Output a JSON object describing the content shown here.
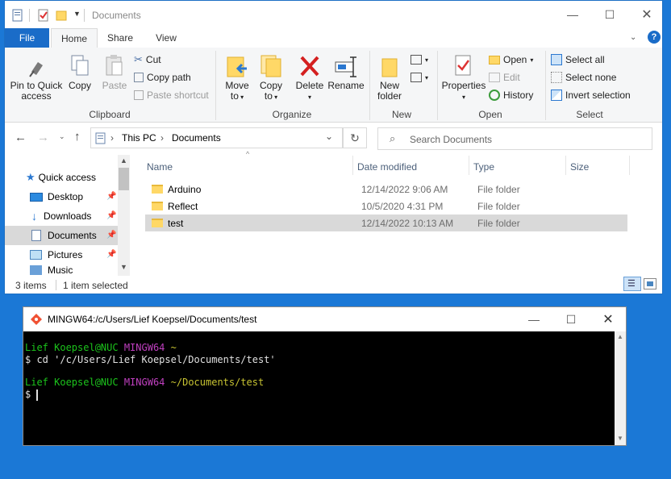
{
  "explorer": {
    "title": "Documents",
    "tabs": {
      "file": "File",
      "home": "Home",
      "share": "Share",
      "view": "View"
    },
    "ribbon": {
      "clipboard": {
        "pin": "Pin to Quick access",
        "copy": "Copy",
        "paste": "Paste",
        "cut": "Cut",
        "copy_path": "Copy path",
        "paste_shortcut": "Paste shortcut",
        "label": "Clipboard"
      },
      "organize": {
        "move_to": "Move to",
        "copy_to": "Copy to",
        "delete": "Delete",
        "rename": "Rename",
        "label": "Organize"
      },
      "new": {
        "new_folder": "New folder",
        "label": "New"
      },
      "open": {
        "properties": "Properties",
        "open": "Open",
        "edit": "Edit",
        "history": "History",
        "label": "Open"
      },
      "select": {
        "select_all": "Select all",
        "select_none": "Select none",
        "invert": "Invert selection",
        "label": "Select"
      }
    },
    "address": {
      "this_pc": "This PC",
      "documents": "Documents"
    },
    "search_placeholder": "Search Documents",
    "nav": {
      "quick_access": "Quick access",
      "items": [
        "Desktop",
        "Downloads",
        "Documents",
        "Pictures",
        "Music"
      ]
    },
    "columns": {
      "name": "Name",
      "date": "Date modified",
      "type": "Type",
      "size": "Size"
    },
    "files": [
      {
        "name": "Arduino",
        "date": "12/14/2022 9:06 AM",
        "type": "File folder"
      },
      {
        "name": "Reflect",
        "date": "10/5/2020 4:31 PM",
        "type": "File folder"
      },
      {
        "name": "test",
        "date": "12/14/2022 10:13 AM",
        "type": "File folder"
      }
    ],
    "status": {
      "count": "3 items",
      "selected": "1 item selected"
    }
  },
  "terminal": {
    "title": "MINGW64:/c/Users/Lief Koepsel/Documents/test",
    "line1_user": "Lief Koepsel@NUC",
    "line1_env": "MINGW64",
    "line1_path": "~",
    "line2": "$ cd '/c/Users/Lief Koepsel/Documents/test'",
    "line3_user": "Lief Koepsel@NUC",
    "line3_env": "MINGW64",
    "line3_path": "~/Documents/test",
    "prompt": "$"
  }
}
